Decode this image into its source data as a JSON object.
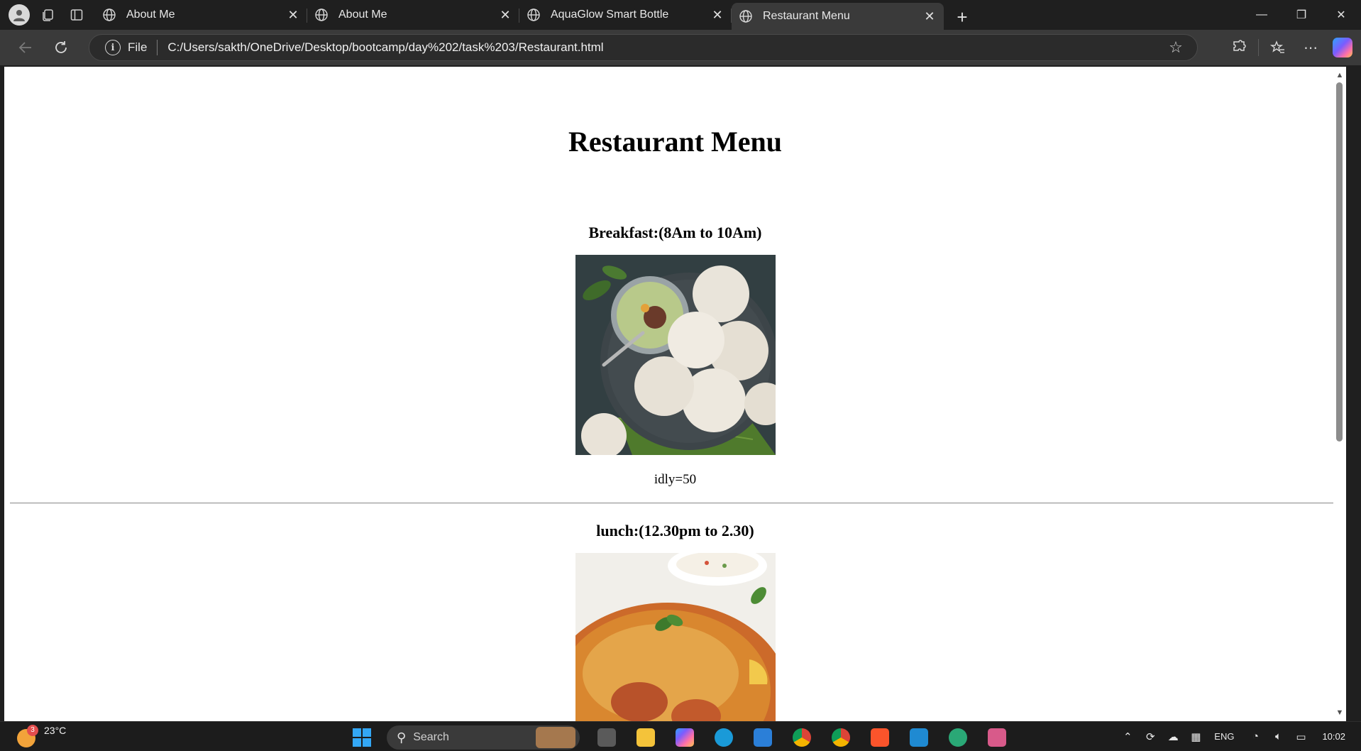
{
  "browser": {
    "tabs": [
      {
        "title": "About Me",
        "active": false
      },
      {
        "title": "About Me",
        "active": false
      },
      {
        "title": "AquaGlow Smart Bottle",
        "active": false
      },
      {
        "title": "Restaurant Menu",
        "active": true
      }
    ],
    "address": {
      "scheme_label": "File",
      "url": "C:/Users/sakth/OneDrive/Desktop/bootcamp/day%202/task%203/Restaurant.html"
    }
  },
  "page": {
    "heading": "Restaurant Menu",
    "sections": [
      {
        "title": "Breakfast:(8Am to 10Am)",
        "item": "idly=50"
      },
      {
        "title": "lunch:(12.30pm to 2.30)"
      }
    ]
  },
  "taskbar": {
    "weather_temp": "23°C",
    "weather_badge": "3",
    "search_label": "Search",
    "language": "ENG",
    "time": "10:02"
  },
  "colors": {
    "browser_chrome": "#1f1f1f",
    "toolbar": "#3a3a3a",
    "page_bg": "#ffffff",
    "taskbar": "#1c1c1c",
    "windows_blue": "#33a7f5"
  }
}
